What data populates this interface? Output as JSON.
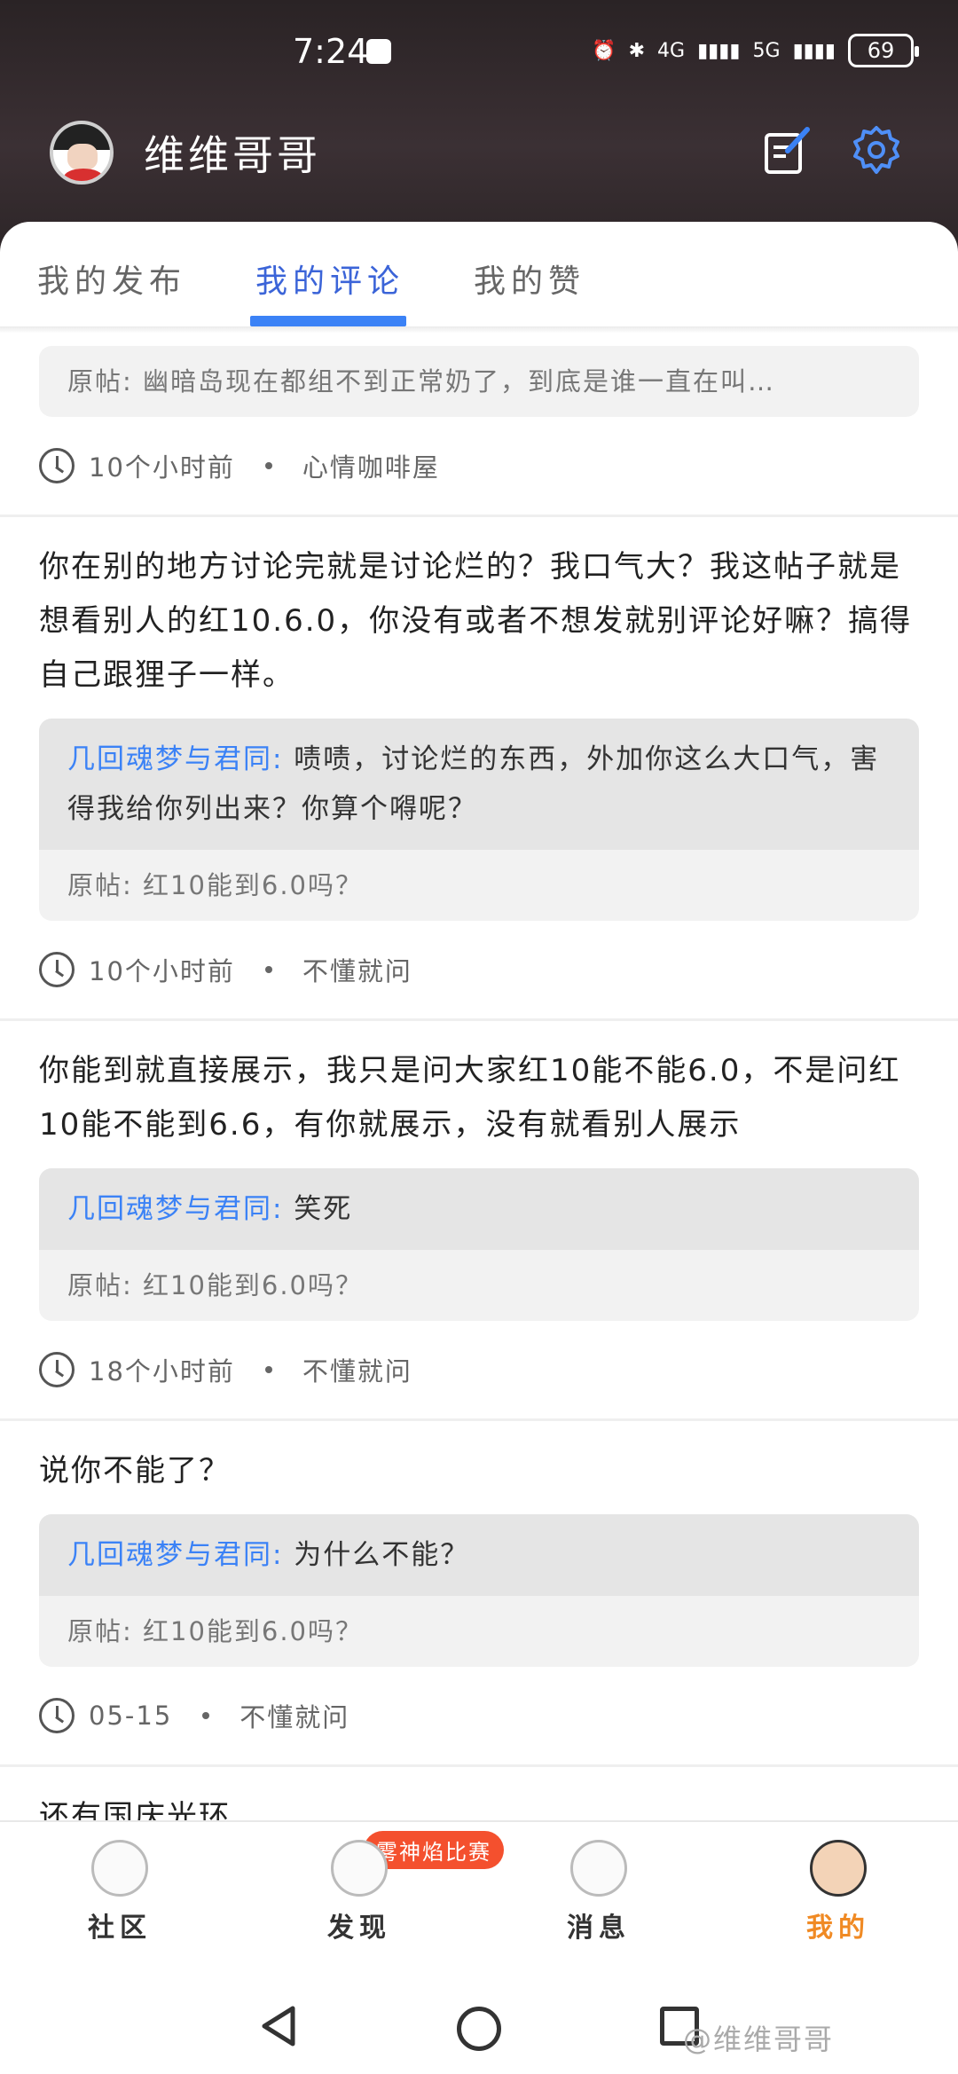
{
  "status_bar": {
    "time": "7:24",
    "net1": "4G",
    "net2": "5G",
    "battery": "69"
  },
  "header": {
    "username": "维维哥哥"
  },
  "tabs": [
    {
      "label": "我的发布"
    },
    {
      "label": "我的评论"
    },
    {
      "label": "我的赞"
    }
  ],
  "feed": {
    "partial": {
      "original": "原帖: 幽暗岛现在都组不到正常奶了，到底是谁一直在叫…",
      "time": "10个小时前",
      "forum": "心情咖啡屋"
    },
    "items": [
      {
        "text": "你在别的地方讨论完就是讨论烂的？我口气大？我这帖子就是想看别人的红10.6.0，你没有或者不想发就别评论好嘛？搞得自己跟狸子一样。",
        "reply_author": "几回魂梦与君同:",
        "reply_text": " 啧啧，讨论烂的东西，外加你这么大口气，害得我给你列出来？你算个嘚呢？",
        "original": "原帖: 红10能到6.0吗？",
        "time": "10个小时前",
        "forum": "不懂就问"
      },
      {
        "text": "你能到就直接展示，我只是问大家红10能不能6.0，不是问红10能不能到6.6，有你就展示，没有就看别人展示",
        "reply_author": "几回魂梦与君同:",
        "reply_text": " 笑死",
        "original": "原帖: 红10能到6.0吗？",
        "time": "18个小时前",
        "forum": "不懂就问"
      },
      {
        "text": "说你不能了？",
        "reply_author": "几回魂梦与君同:",
        "reply_text": " 为什么不能？",
        "original": "原帖: 红10能到6.0吗？",
        "time": "05-15",
        "forum": "不懂就问"
      },
      {
        "text": "还有国庆光环"
      }
    ]
  },
  "bottom_nav": [
    {
      "label": "社区"
    },
    {
      "label": "发现",
      "badge": "雾神焰比赛"
    },
    {
      "label": "消息"
    },
    {
      "label": "我的"
    }
  ],
  "watermark": "@维维哥哥",
  "colors": {
    "accent_blue": "#3b82f6",
    "active_orange": "#f08a24",
    "badge_red": "#f4502e"
  }
}
